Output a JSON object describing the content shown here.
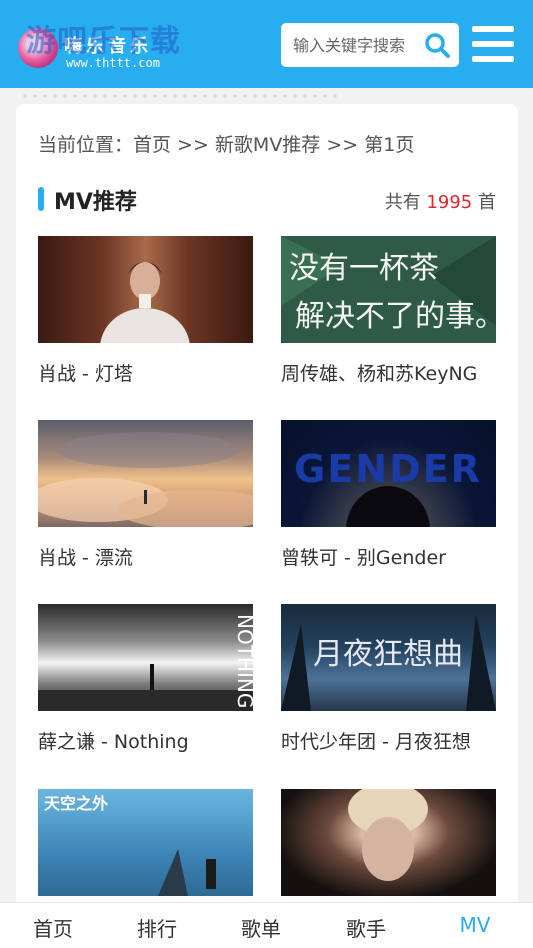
{
  "header": {
    "logo_watermark": "游吧乐下载",
    "logo_brand": "嗨乐音乐",
    "logo_url": "www.thttt.com",
    "search_placeholder": "输入关键字搜索",
    "brand_color": "#27aef0"
  },
  "breadcrumb": "当前位置：首页 >> 新歌MV推荐 >> 第1页",
  "section": {
    "title": "MV推荐",
    "count_prefix": "共有",
    "count": "1995",
    "count_suffix": "首"
  },
  "mv_list": [
    {
      "title": "肖战 - 灯塔"
    },
    {
      "title": "周传雄、杨和苏KeyNG",
      "thumb_text_line1": "没有一杯茶",
      "thumb_text_line2": "解决不了的事。"
    },
    {
      "title": "肖战 - 漂流"
    },
    {
      "title": "曾轶可 - 别Gender",
      "thumb_text": "GENDER"
    },
    {
      "title": "薛之谦 - Nothing",
      "thumb_text": "NOTHING"
    },
    {
      "title": "时代少年团 - 月夜狂想",
      "thumb_text": "月夜狂想曲"
    },
    {
      "title": "",
      "thumb_text": "天空之外"
    },
    {
      "title": ""
    }
  ],
  "tabbar": [
    {
      "label": "首页"
    },
    {
      "label": "排行"
    },
    {
      "label": "歌单"
    },
    {
      "label": "歌手"
    },
    {
      "label": "MV"
    }
  ],
  "icons": {
    "search": "search-icon",
    "menu": "hamburger-menu-icon"
  }
}
